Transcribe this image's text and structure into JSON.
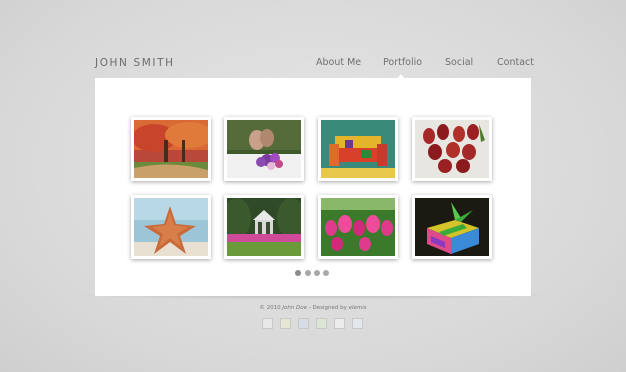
{
  "header": {
    "logo": "JOHN SMITH"
  },
  "nav": {
    "items": [
      {
        "label": "About Me",
        "active": false
      },
      {
        "label": "Portfolio",
        "active": true
      },
      {
        "label": "Social",
        "active": false
      },
      {
        "label": "Contact",
        "active": false
      }
    ]
  },
  "gallery": {
    "thumbnails": [
      {
        "subject": "autumn-trees"
      },
      {
        "subject": "wedding-bouquet"
      },
      {
        "subject": "colorful-armchair"
      },
      {
        "subject": "red-tulips-bunch"
      },
      {
        "subject": "starfish"
      },
      {
        "subject": "garden-gazebo"
      },
      {
        "subject": "pink-tulip-field"
      },
      {
        "subject": "gift-box"
      }
    ],
    "pagination": {
      "pages": 4,
      "current": 1
    }
  },
  "footer": {
    "year": "© 2010",
    "name": "John Doe",
    "separator": " - Designed by ",
    "designer": "elemis"
  },
  "colors": {
    "background": "#dcdcdc",
    "panel": "#ffffff",
    "text": "#707070",
    "swatches": [
      "#e8e8e8",
      "#e6e6d6",
      "#d8dce4",
      "#dce6d4",
      "#ececec",
      "#e2e8ee"
    ]
  }
}
